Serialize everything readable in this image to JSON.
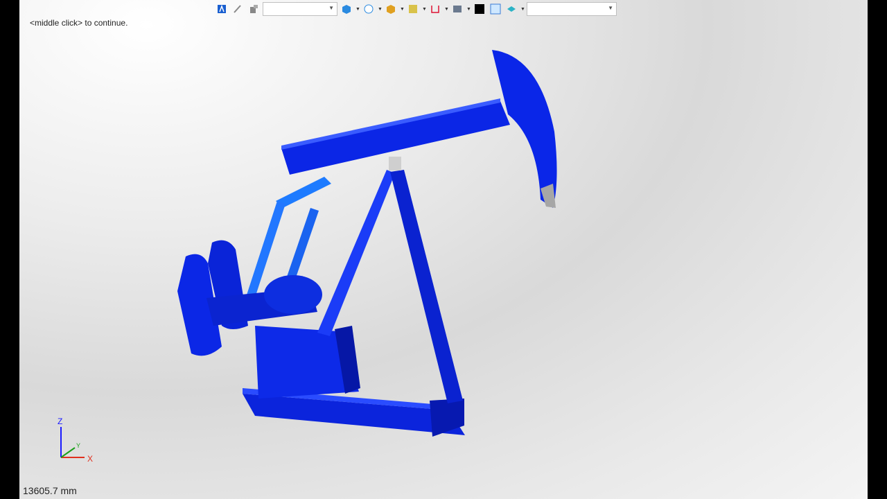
{
  "toolbar": {
    "icons": [
      "app-logo-icon",
      "sketch-tool-icon",
      "filter-tool-icon",
      "view-cube-icon",
      "sphere-view-icon",
      "shaded-box-icon",
      "render-style-icon",
      "section-tool-icon",
      "display-mode-icon",
      "color-black-icon",
      "color-light-blue-icon",
      "material-icon"
    ],
    "combo_left_value": "",
    "combo_right_value": ""
  },
  "viewport": {
    "hint": "<middle click> to continue.",
    "scale_readout": "13605.7 mm"
  },
  "triad": {
    "z_label": "Z",
    "x_label": "X",
    "y_label": "Y"
  },
  "colors": {
    "model_blue": "#0a25e6",
    "model_dark": "#051a9c",
    "accent_gray": "#a6a6a6"
  }
}
